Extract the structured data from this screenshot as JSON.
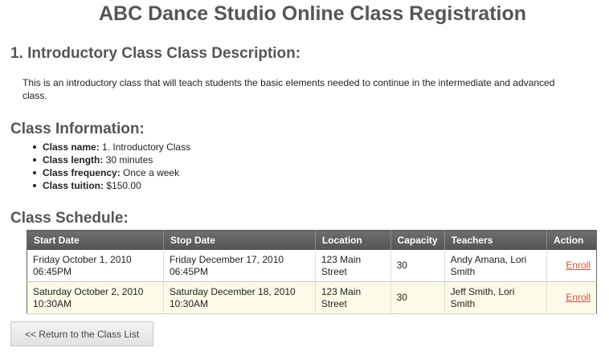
{
  "page_title": "ABC Dance Studio Online Class Registration",
  "description": {
    "heading": "1. Introductory Class Class Description:",
    "text": "This is an introductory class that will teach students the basic elements needed to continue in the intermediate and advanced class."
  },
  "class_info": {
    "heading": "Class Information:",
    "items": [
      {
        "label": "Class name:",
        "value": "1. Introductory Class"
      },
      {
        "label": "Class length:",
        "value": "30 minutes"
      },
      {
        "label": "Class frequency:",
        "value": "Once a week"
      },
      {
        "label": "Class tuition:",
        "value": "$150.00"
      }
    ]
  },
  "schedule": {
    "heading": "Class Schedule:",
    "columns": [
      "Start Date",
      "Stop Date",
      "Location",
      "Capacity",
      "Teachers",
      "Action"
    ],
    "rows": [
      {
        "start_date": "Friday October 1, 2010",
        "start_time": "06:45PM",
        "stop_date": "Friday December 17, 2010",
        "stop_time": "06:45PM",
        "location_1": "123 Main",
        "location_2": "Street",
        "capacity": "30",
        "teachers_1": "Andy Amana, Lori",
        "teachers_2": "Smith",
        "action": "Enroll"
      },
      {
        "start_date": "Saturday October 2, 2010",
        "start_time": "10:30AM",
        "stop_date": "Saturday December 18, 2010",
        "stop_time": "10:30AM",
        "location_1": "123 Main",
        "location_2": "Street",
        "capacity": "30",
        "teachers_1": "Jeff Smith, Lori",
        "teachers_2": "Smith",
        "action": "Enroll"
      }
    ]
  },
  "back_button_label": "<< Return to the Class List",
  "colors": {
    "heading": "#555555",
    "table_header": "#606060",
    "row_alt": "#fbfbe8",
    "link": "#c8543c"
  }
}
